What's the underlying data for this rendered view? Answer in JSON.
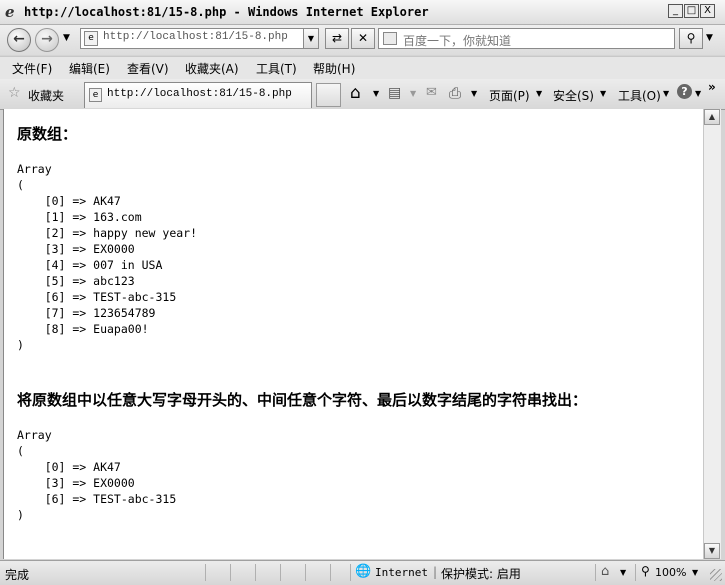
{
  "window": {
    "title": "http://localhost:81/15-8.php - Windows Internet Explorer",
    "minimize": "_",
    "maximize": "□",
    "close": "X"
  },
  "address_bar": {
    "url": "http://localhost:81/15-8.php",
    "search_placeholder": "百度一下，你就知道"
  },
  "menu": [
    "文件(F)",
    "编辑(E)",
    "查看(V)",
    "收藏夹(A)",
    "工具(T)",
    "帮助(H)"
  ],
  "toolbar": {
    "favorites_label": "收藏夹",
    "tab_title": "http://localhost:81/15-8.php",
    "page_label": "页面(P)",
    "safety_label": "安全(S)",
    "tools_label": "工具(O)"
  },
  "page": {
    "heading1": "原数组：",
    "array1_open": "Array\n(",
    "array1_items": [
      "    [0] => AK47",
      "    [1] => 163.com",
      "    [2] => happy new year!",
      "    [3] => EX0000",
      "    [4] => 007 in USA",
      "    [5] => abc123",
      "    [6] => TEST-abc-315",
      "    [7] => 123654789",
      "    [8] => Euapa00!"
    ],
    "array1_close": ")",
    "heading2": "将原数组中以任意大写字母开头的、中间任意个字符、最后以数字结尾的字符串找出：",
    "array2_open": "Array\n(",
    "array2_items": [
      "    [0] => AK47",
      "    [3] => EX0000",
      "    [6] => TEST-abc-315"
    ],
    "array2_close": ")"
  },
  "status": {
    "text": "完成",
    "zone": "Internet",
    "protected_mode": "保护模式: 启用",
    "zoom": "100%"
  }
}
